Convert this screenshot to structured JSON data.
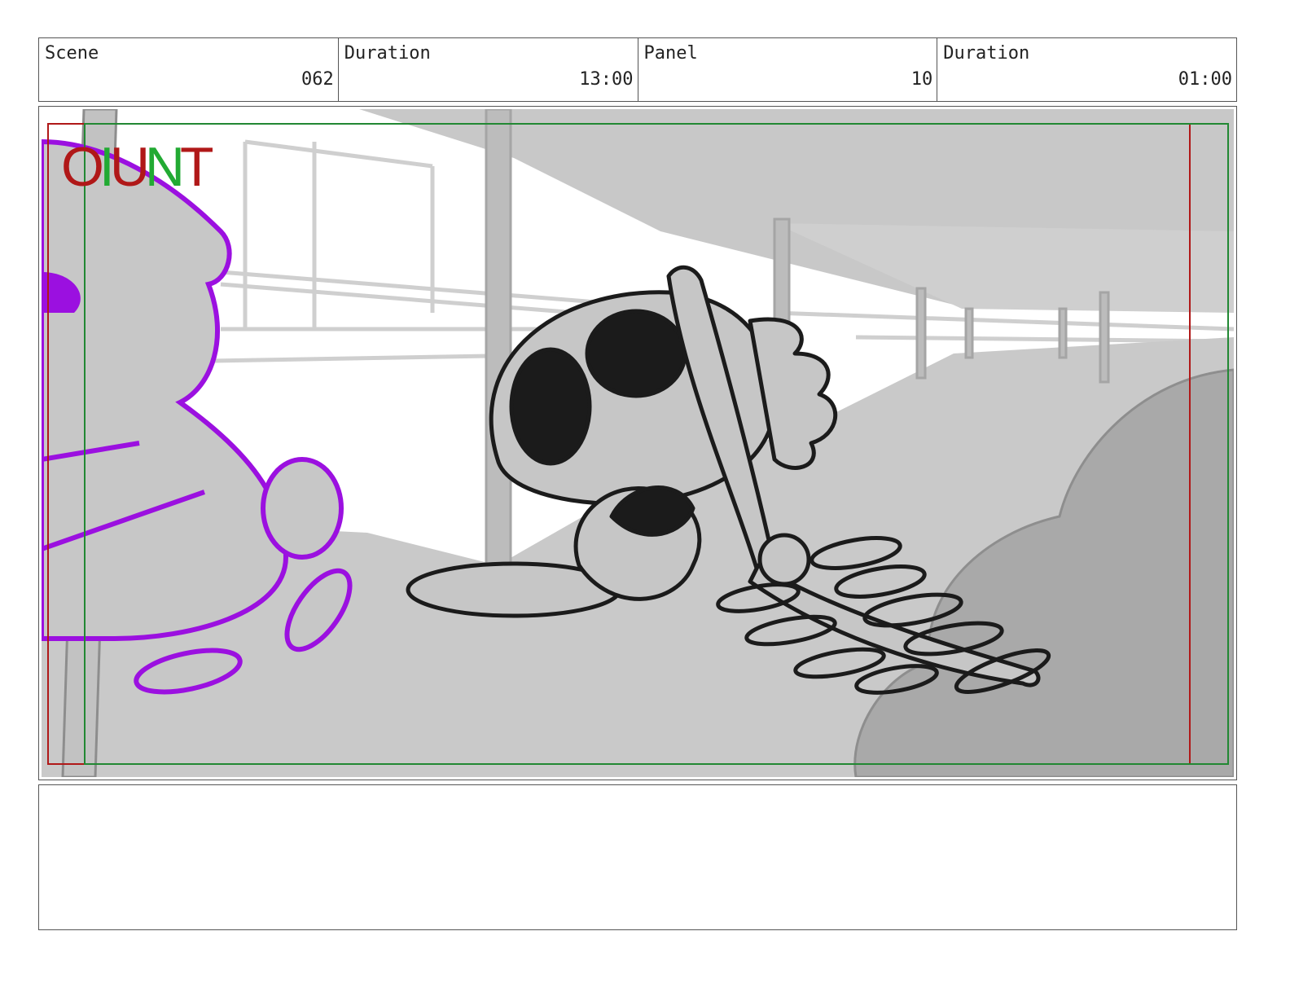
{
  "header": {
    "scene_label": "Scene",
    "scene_value": "062",
    "scene_duration_label": "Duration",
    "scene_duration_value": "13:00",
    "panel_label": "Panel",
    "panel_value": "10",
    "panel_duration_label": "Duration",
    "panel_duration_value": "01:00"
  },
  "frame": {
    "marker_letters": [
      "O",
      "I",
      "U",
      "N",
      "T"
    ],
    "safe_out_color": "#b01818",
    "safe_in_color": "#228833"
  },
  "notes": {
    "text": ""
  }
}
